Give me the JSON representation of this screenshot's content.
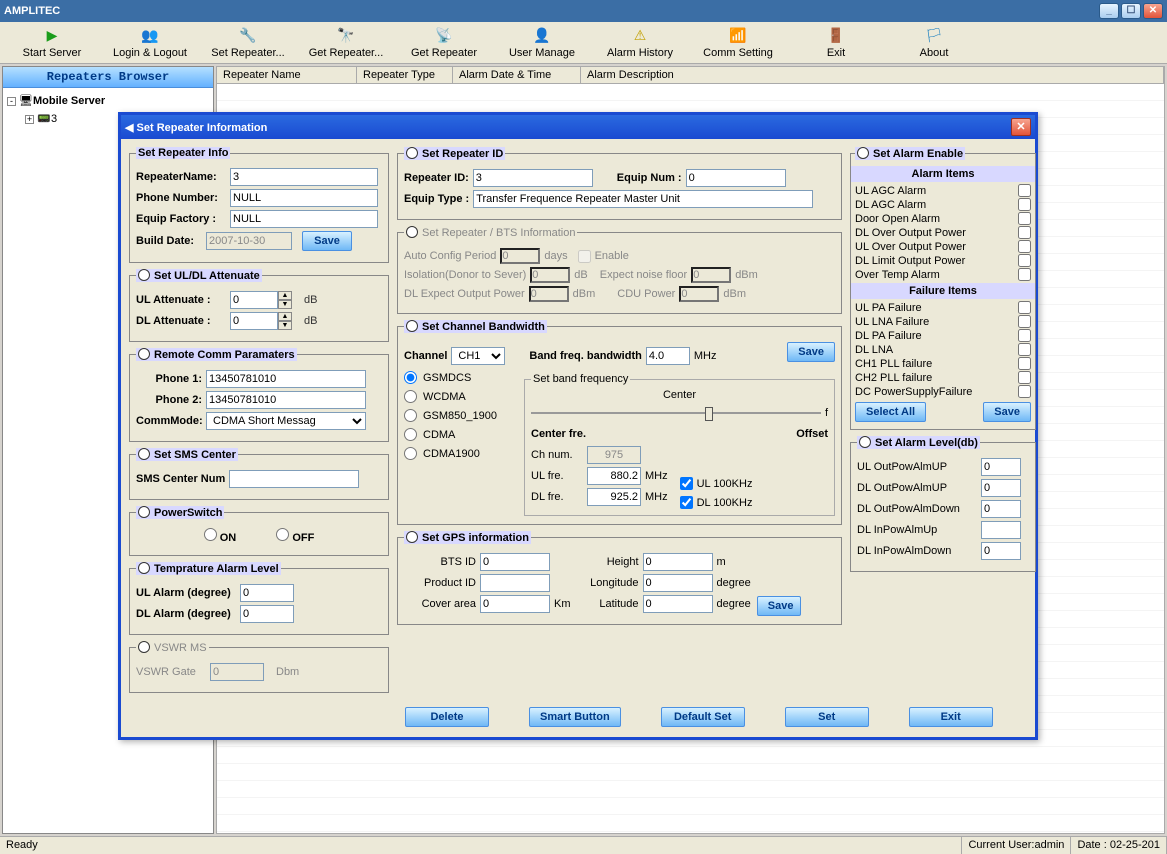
{
  "window": {
    "title": "AMPLITEC"
  },
  "toolbar": [
    {
      "glyph": "▶",
      "color": "#1a9c1a",
      "label": "Start Server"
    },
    {
      "glyph": "👥",
      "color": "#c83a3a",
      "label": "Login & Logout"
    },
    {
      "glyph": "🔧",
      "color": "#1a7fc0",
      "label": "Set Repeater..."
    },
    {
      "glyph": "🔭",
      "color": "#333",
      "label": "Get Repeater..."
    },
    {
      "glyph": "📡",
      "color": "#c83a3a",
      "label": "Get Repeater"
    },
    {
      "glyph": "👤",
      "color": "#3a6ec0",
      "label": "User Manage"
    },
    {
      "glyph": "⚠",
      "color": "#c2a000",
      "label": "Alarm History"
    },
    {
      "glyph": "📶",
      "color": "#1a7fc0",
      "label": "Comm Setting"
    },
    {
      "glyph": "🚪",
      "color": "#b25a00",
      "label": "Exit"
    },
    {
      "glyph": "🏳",
      "color": "#1a7fc0",
      "label": "About"
    }
  ],
  "sidebar": {
    "title": "Repeaters Browser",
    "root": "Mobile Server",
    "child": "3"
  },
  "columns": {
    "c1": "Repeater Name",
    "c2": "Repeater Type",
    "c3": "Alarm Date & Time",
    "c4": "Alarm Description"
  },
  "status": {
    "left": "Ready",
    "user": "Current User:admin",
    "date": "Date : 02-25-201"
  },
  "dlg": {
    "title": "Set Repeater Information",
    "info": {
      "legend": "Set Repeater Info",
      "name_l": "RepeaterName:",
      "name_v": "3",
      "phone_l": "Phone Number:",
      "phone_v": "NULL",
      "fac_l": "Equip  Factory :",
      "fac_v": "NULL",
      "date_l": "Build Date:",
      "date_v": "2007-10-30",
      "save": "Save"
    },
    "att": {
      "legend": "Set UL/DL Attenuate",
      "ul_l": "UL Attenuate :",
      "ul_v": "0",
      "dl_l": "DL Attenuate :",
      "dl_v": "0",
      "unit": "dB"
    },
    "comm": {
      "legend": "Remote Comm Paramaters",
      "p1_l": "Phone 1:",
      "p1_v": "13450781010",
      "p2_l": "Phone 2:",
      "p2_v": "13450781010",
      "mode_l": "CommMode:",
      "mode_v": "CDMA Short Messag"
    },
    "sms": {
      "legend": "Set SMS Center",
      "num_l": "SMS Center Num",
      "num_v": ""
    },
    "pwr": {
      "legend": "PowerSwitch",
      "on": "ON",
      "off": "OFF"
    },
    "temp": {
      "legend": "Temprature Alarm Level",
      "ul_l": "UL Alarm (degree)",
      "ul_v": "0",
      "dl_l": "DL Alarm (degree)",
      "dl_v": "0"
    },
    "vswr": {
      "legend": "VSWR MS",
      "gate_l": "VSWR Gate",
      "gate_v": "0",
      "unit": "Dbm"
    },
    "repid": {
      "legend": "Set Repeater ID",
      "id_l": "Repeater ID:",
      "id_v": "3",
      "eq_l": "Equip Num :",
      "eq_v": "0",
      "type_l": "Equip Type :",
      "type_v": "Transfer Frequence Repeater Master Unit"
    },
    "bts": {
      "legend": "Set  Repeater / BTS Information",
      "acp_l": "Auto Config Period",
      "acp_v": "0",
      "acp_u": "days",
      "enable": "Enable",
      "iso_l": "Isolation(Donor to Sever)",
      "iso_v": "0",
      "iso_u": "dB",
      "enf_l": "Expect noise floor",
      "enf_v": "0",
      "enf_u": "dBm",
      "dle_l": "DL Expect Output Power",
      "dle_v": "0",
      "dle_u": "dBm",
      "cdu_l": "CDU Power",
      "cdu_v": "0",
      "cdu_u": "dBm"
    },
    "chbw": {
      "legend": "Set Channel Bandwidth",
      "save": "Save",
      "ch_l": "Channel",
      "ch_v": "CH1",
      "bw_l": "Band freq. bandwidth",
      "bw_v": "4.0",
      "bw_u": "MHz",
      "modes": [
        "GSMDCS",
        "WCDMA",
        "GSM850_1900",
        "CDMA",
        "CDMA1900"
      ],
      "bf": {
        "legend": "Set band frequency",
        "center": "Center",
        "f": "f",
        "cf": "Center fre.",
        "off": "Offset",
        "chn_l": "Ch num.",
        "chn_v": "975",
        "ulf_l": "UL fre.",
        "ulf_v": "880.2",
        "u": "MHz",
        "dlf_l": "DL fre.",
        "dlf_v": "925.2",
        "ul100": "UL 100KHz",
        "dl100": "DL 100KHz"
      }
    },
    "gps": {
      "legend": "Set GPS information",
      "save": "Save",
      "bts_l": "BTS ID",
      "bts_v": "0",
      "prod_l": "Product ID",
      "prod_v": "",
      "cov_l": "Cover area",
      "cov_v": "0",
      "cov_u": "Km",
      "h_l": "Height",
      "h_v": "0",
      "h_u": "m",
      "lon_l": "Longitude",
      "lon_v": "0",
      "lon_u": "degree",
      "lat_l": "Latitude",
      "lat_v": "0",
      "lat_u": "degree"
    },
    "alarm": {
      "legend": "Set Alarm Enable",
      "hdr1": "Alarm Items",
      "hdr2": "Failure Items",
      "items1": [
        "UL AGC Alarm",
        "DL AGC Alarm",
        "Door Open Alarm",
        "DL Over Output Power",
        "UL Over Output Power",
        "DL Limit Output Power",
        "Over Temp Alarm"
      ],
      "items2": [
        "UL PA Failure",
        "UL LNA Failure",
        "DL PA Failure",
        "DL LNA",
        "CH1 PLL failure",
        "CH2 PLL failure",
        "DC PowerSupplyFailure"
      ],
      "selall": "Select All",
      "save": "Save"
    },
    "almlvl": {
      "legend": "Set Alarm Level(db)",
      "rows": [
        {
          "l": "UL OutPowAlmUP",
          "v": "0"
        },
        {
          "l": "DL OutPowAlmUP",
          "v": "0"
        },
        {
          "l": "DL OutPowAlmDown",
          "v": "0"
        },
        {
          "l": "DL InPowAlmUp",
          "v": ""
        },
        {
          "l": "DL InPowAlmDown",
          "v": "0"
        }
      ]
    },
    "btns": {
      "del": "Delete",
      "smart": "Smart Button",
      "def": "Default Set",
      "set": "Set",
      "exit": "Exit"
    }
  }
}
